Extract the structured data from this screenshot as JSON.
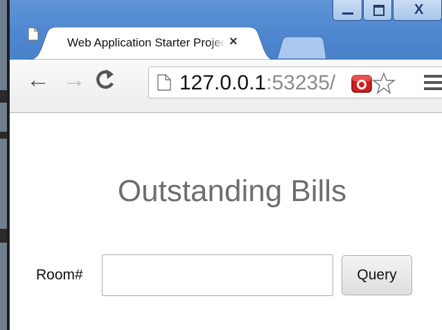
{
  "tab": {
    "title": "Web Application Starter Project",
    "close_glyph": "×"
  },
  "window_controls": {
    "minimize": "minimize-icon",
    "maximize": "maximize-icon",
    "close": "X"
  },
  "toolbar": {
    "back": "←",
    "forward": "→",
    "reload": "reload-icon",
    "url_host": "127.0.0.1",
    "url_port": ":53235/"
  },
  "page": {
    "heading": "Outstanding Bills",
    "room_label": "Room#",
    "room_value": "",
    "query_label": "Query"
  },
  "colors": {
    "titlebar": "#4e86cf",
    "heading": "#6e6e6e"
  }
}
